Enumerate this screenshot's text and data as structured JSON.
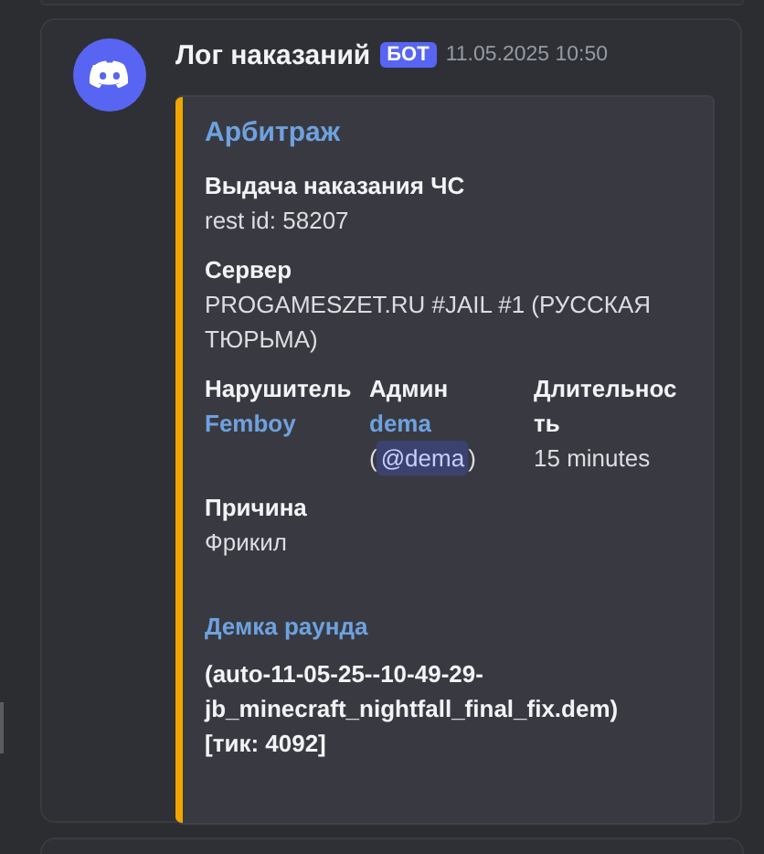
{
  "message": {
    "author": "Лог наказаний",
    "badge": "БОТ",
    "timestamp": "11.05.2025 10:50",
    "embed": {
      "title": "Арбитраж",
      "fields": [
        {
          "name": "Выдача наказания ЧС",
          "inline": false,
          "value": [
            {
              "kind": "text",
              "text": "rest id: 58207"
            }
          ]
        },
        {
          "name": "Сервер",
          "inline": false,
          "value": [
            {
              "kind": "text",
              "text": "PROGAMESZET.RU #JAIL #1 (РУССКАЯ ТЮРЬМА)"
            }
          ]
        },
        {
          "name": "Нарушитель",
          "inline": true,
          "value": [
            {
              "kind": "link",
              "text": "Femboy"
            }
          ]
        },
        {
          "name": "Админ",
          "inline": true,
          "value": [
            {
              "kind": "link",
              "text": "dema"
            },
            {
              "kind": "mention",
              "before": "(",
              "text": "@dema",
              "after": ")"
            }
          ]
        },
        {
          "name": "Длительность",
          "inline": true,
          "value": [
            {
              "kind": "text",
              "text": "15 minutes"
            }
          ]
        },
        {
          "name": "Причина",
          "inline": false,
          "value": [
            {
              "kind": "text",
              "text": "Фрикил"
            }
          ]
        }
      ],
      "section_title": "Демка раунда",
      "demo": "(auto-11-05-25--10-49-29-jb_minecraft_nightfall_final_fix.dem)\n[тик: 4092]"
    }
  }
}
